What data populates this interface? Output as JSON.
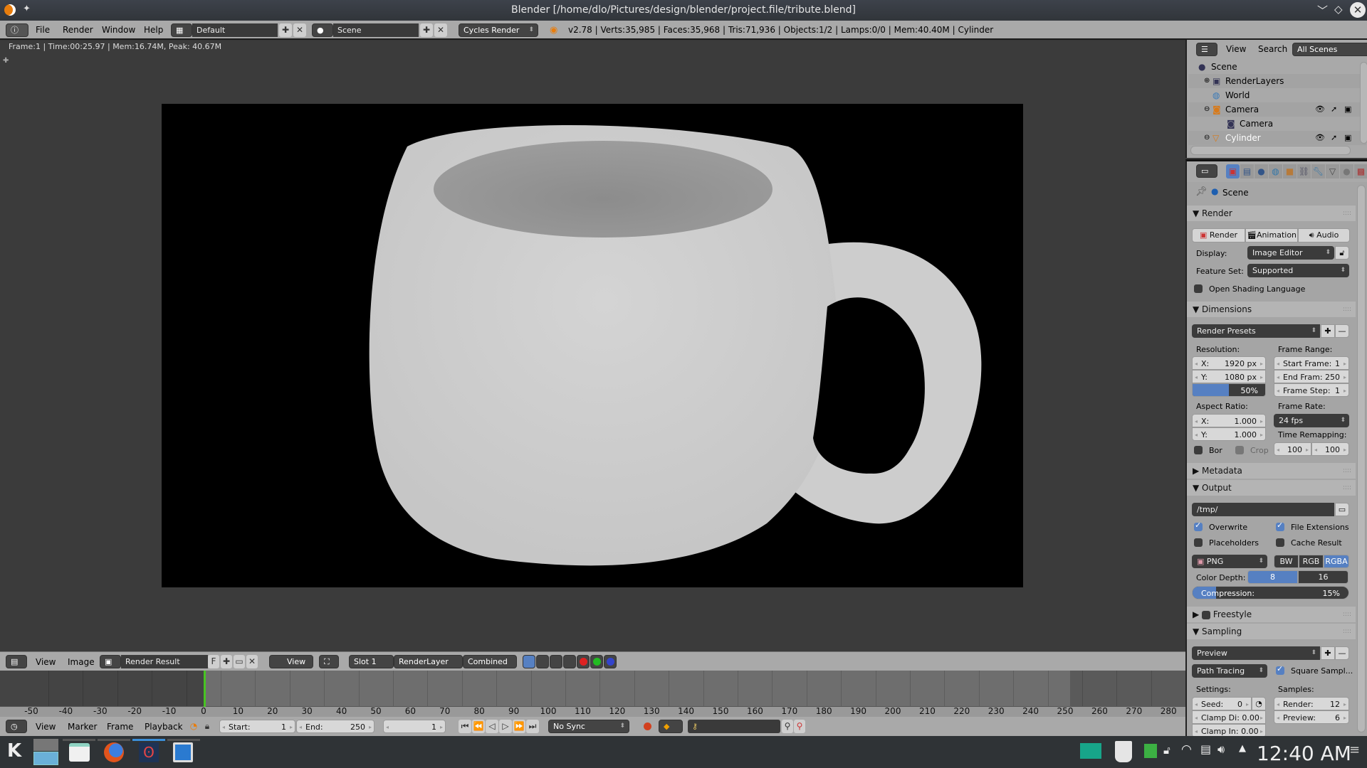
{
  "window": {
    "title": "Blender [/home/dlo/Pictures/design/blender/project.file/tribute.blend]"
  },
  "info_header": {
    "menus": [
      "File",
      "Render",
      "Window",
      "Help"
    ],
    "screen_layout": "Default",
    "scene": "Scene",
    "render_engine": "Cycles Render",
    "stats": "v2.78 | Verts:35,985 | Faces:35,968 | Tris:71,936 | Objects:1/2 | Lamps:0/0 | Mem:40.40M | Cylinder"
  },
  "image_editor": {
    "render_info": "Frame:1 | Time:00:25.97 | Mem:16.74M, Peak: 40.67M",
    "canvas_subject": "rendered white mug on black background",
    "header": {
      "menus": [
        "View",
        "Image"
      ],
      "image_name": "Render Result",
      "fake_user": "F",
      "view_label": "View",
      "slot": "Slot 1",
      "render_layer": "RenderLayer",
      "pass": "Combined"
    }
  },
  "timeline": {
    "ticks": [
      -50,
      -40,
      -30,
      -20,
      -10,
      0,
      10,
      20,
      30,
      40,
      50,
      60,
      70,
      80,
      90,
      100,
      110,
      120,
      130,
      140,
      150,
      160,
      170,
      180,
      190,
      200,
      210,
      220,
      230,
      240,
      250,
      260,
      270,
      280
    ],
    "current_frame_marker": 0,
    "header": {
      "menus": [
        "View",
        "Marker",
        "Frame",
        "Playback"
      ],
      "start_label": "Start:",
      "start_value": "1",
      "end_label": "End:",
      "end_value": "250",
      "current_frame": "1",
      "sync": "No Sync"
    }
  },
  "outliner": {
    "menus": [
      "View",
      "Search"
    ],
    "filter": "All Scenes",
    "items": [
      {
        "label": "Scene",
        "indent": 0,
        "icon": "scene-icon"
      },
      {
        "label": "RenderLayers",
        "indent": 1,
        "icon": "renderlayers-icon"
      },
      {
        "label": "World",
        "indent": 1,
        "icon": "world-icon"
      },
      {
        "label": "Camera",
        "indent": 1,
        "icon": "camera-object-icon"
      },
      {
        "label": "Camera",
        "indent": 2,
        "icon": "camera-data-icon"
      },
      {
        "label": "Cylinder",
        "indent": 1,
        "icon": "mesh-icon"
      }
    ]
  },
  "properties": {
    "context": "Scene",
    "render": {
      "title": "Render",
      "buttons": [
        "Render",
        "Animation",
        "Audio"
      ],
      "display_label": "Display:",
      "display_value": "Image Editor",
      "feature_set_label": "Feature Set:",
      "feature_set_value": "Supported",
      "osl_label": "Open Shading Language",
      "osl_checked": false
    },
    "dimensions": {
      "title": "Dimensions",
      "presets": "Render Presets",
      "resolution_label": "Resolution:",
      "res_x_label": "X:",
      "res_x": "1920 px",
      "res_y_label": "Y:",
      "res_y": "1080 px",
      "res_pct": "50%",
      "res_pct_value": 50,
      "frame_range_label": "Frame Range:",
      "start_frame": "Start Frame:",
      "start_frame_value": "1",
      "end_frame": "End Fram:",
      "end_frame_value": "250",
      "frame_step": "Frame Step:",
      "frame_step_value": "1",
      "aspect_label": "Aspect Ratio:",
      "aspect_x_label": "X:",
      "aspect_x": "1.000",
      "aspect_y_label": "Y:",
      "aspect_y": "1.000",
      "frame_rate_label": "Frame Rate:",
      "frame_rate": "24 fps",
      "time_remap_label": "Time Remapping:",
      "remap_old": "100",
      "remap_new": "100",
      "border_label": "Bor",
      "crop_label": "Crop"
    },
    "metadata": {
      "title": "Metadata"
    },
    "output": {
      "title": "Output",
      "path": "/tmp/",
      "overwrite": "Overwrite",
      "file_extensions": "File Extensions",
      "placeholders": "Placeholders",
      "cache_result": "Cache Result",
      "format": "PNG",
      "color_modes": [
        "BW",
        "RGB",
        "RGBA"
      ],
      "color_mode_selected": "RGBA",
      "color_depth_label": "Color Depth:",
      "depths": [
        "8",
        "16"
      ],
      "depth_selected": "8",
      "compression_label": "Compression:",
      "compression": "15%",
      "compression_value": 15
    },
    "freestyle": {
      "title": "Freestyle"
    },
    "sampling": {
      "title": "Sampling",
      "presets": "Preview",
      "integrator": "Path Tracing",
      "square_samples": "Square Sampl...",
      "settings_label": "Settings:",
      "seed_label": "Seed:",
      "seed": "0",
      "clamp_direct": "Clamp Di: 0.00",
      "clamp_indirect": "Clamp In: 0.00",
      "samples_label": "Samples:",
      "render_label": "Render:",
      "render_samples": "12",
      "preview_label": "Preview:",
      "preview_samples": "6"
    }
  },
  "taskbar": {
    "clock": "12:40 AM"
  }
}
